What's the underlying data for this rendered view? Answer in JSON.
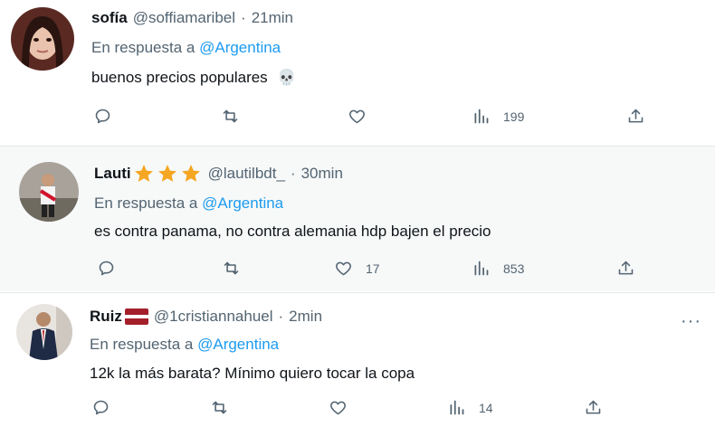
{
  "tweets": [
    {
      "name": "sofía",
      "handle": "@soffiamaribel",
      "time": "21min",
      "reply_prefix": "En respuesta a",
      "reply_to": "@Argentina",
      "text": "buenos precios populares",
      "emoji": "💀",
      "likes": "",
      "views": "199"
    },
    {
      "name": "Lauti",
      "handle": "@lautilbdt_",
      "time": "30min",
      "reply_prefix": "En respuesta a",
      "reply_to": "@Argentina",
      "text": "es contra panama, no contra alemania hdp bajen el precio",
      "likes": "17",
      "views": "853"
    },
    {
      "name": "Ruiz",
      "handle": "@1cristiannahuel",
      "time": "2min",
      "reply_prefix": "En respuesta a",
      "reply_to": "@Argentina",
      "text": "12k la más barata? Mínimo quiero tocar la copa",
      "likes": "",
      "views": "14"
    }
  ],
  "separator_dot": "·",
  "more_label": "···",
  "icons": [
    "reply-icon",
    "retweet-icon",
    "like-icon",
    "views-icon",
    "share-icon",
    "star-icon",
    "flag-icon",
    "more-icon"
  ],
  "colors": {
    "mention": "#1d9bf0",
    "secondary": "#536471",
    "star": "#f5a623",
    "hover_bg": "#f7f9f9"
  }
}
